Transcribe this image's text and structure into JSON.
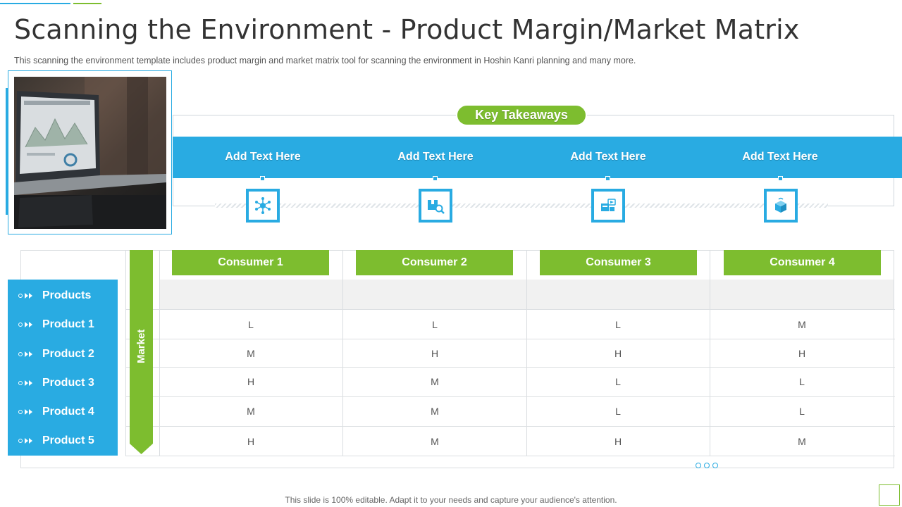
{
  "slide": {
    "title": "Scanning the Environment - Product Margin/Market Matrix",
    "subtitle": "This scanning the environment  template includes product margin and market matrix tool for scanning the environment  in Hoshin Kanri planning and many more.",
    "footer": "This slide is 100% editable. Adapt it to your needs and capture your audience's attention."
  },
  "colors": {
    "blue": "#29abe2",
    "green": "#7dbd2f",
    "grey_row": "#f1f1f1"
  },
  "takeaways": {
    "pill_label": "Key Takeaways",
    "items": [
      {
        "label": "Add  Text Here",
        "icon": "network-nodes-icon"
      },
      {
        "label": "Add  Text Here",
        "icon": "box-search-icon"
      },
      {
        "label": "Add  Text Here",
        "icon": "delivery-box-icon"
      },
      {
        "label": "Add  Text Here",
        "icon": "open-box-icon"
      }
    ]
  },
  "matrix": {
    "market_label": "Market",
    "consumers": [
      "Consumer 1",
      "Consumer 2",
      "Consumer 3",
      "Consumer 4"
    ],
    "products": [
      "Products",
      "Product 1",
      "Product 2",
      "Product 3",
      "Product 4",
      "Product 5"
    ],
    "rows": [
      [
        "L",
        "L",
        "L",
        "M"
      ],
      [
        "M",
        "H",
        "H",
        "H"
      ],
      [
        "H",
        "M",
        "L",
        "L"
      ],
      [
        "M",
        "M",
        "L",
        "L"
      ],
      [
        "H",
        "M",
        "H",
        "M"
      ]
    ]
  }
}
